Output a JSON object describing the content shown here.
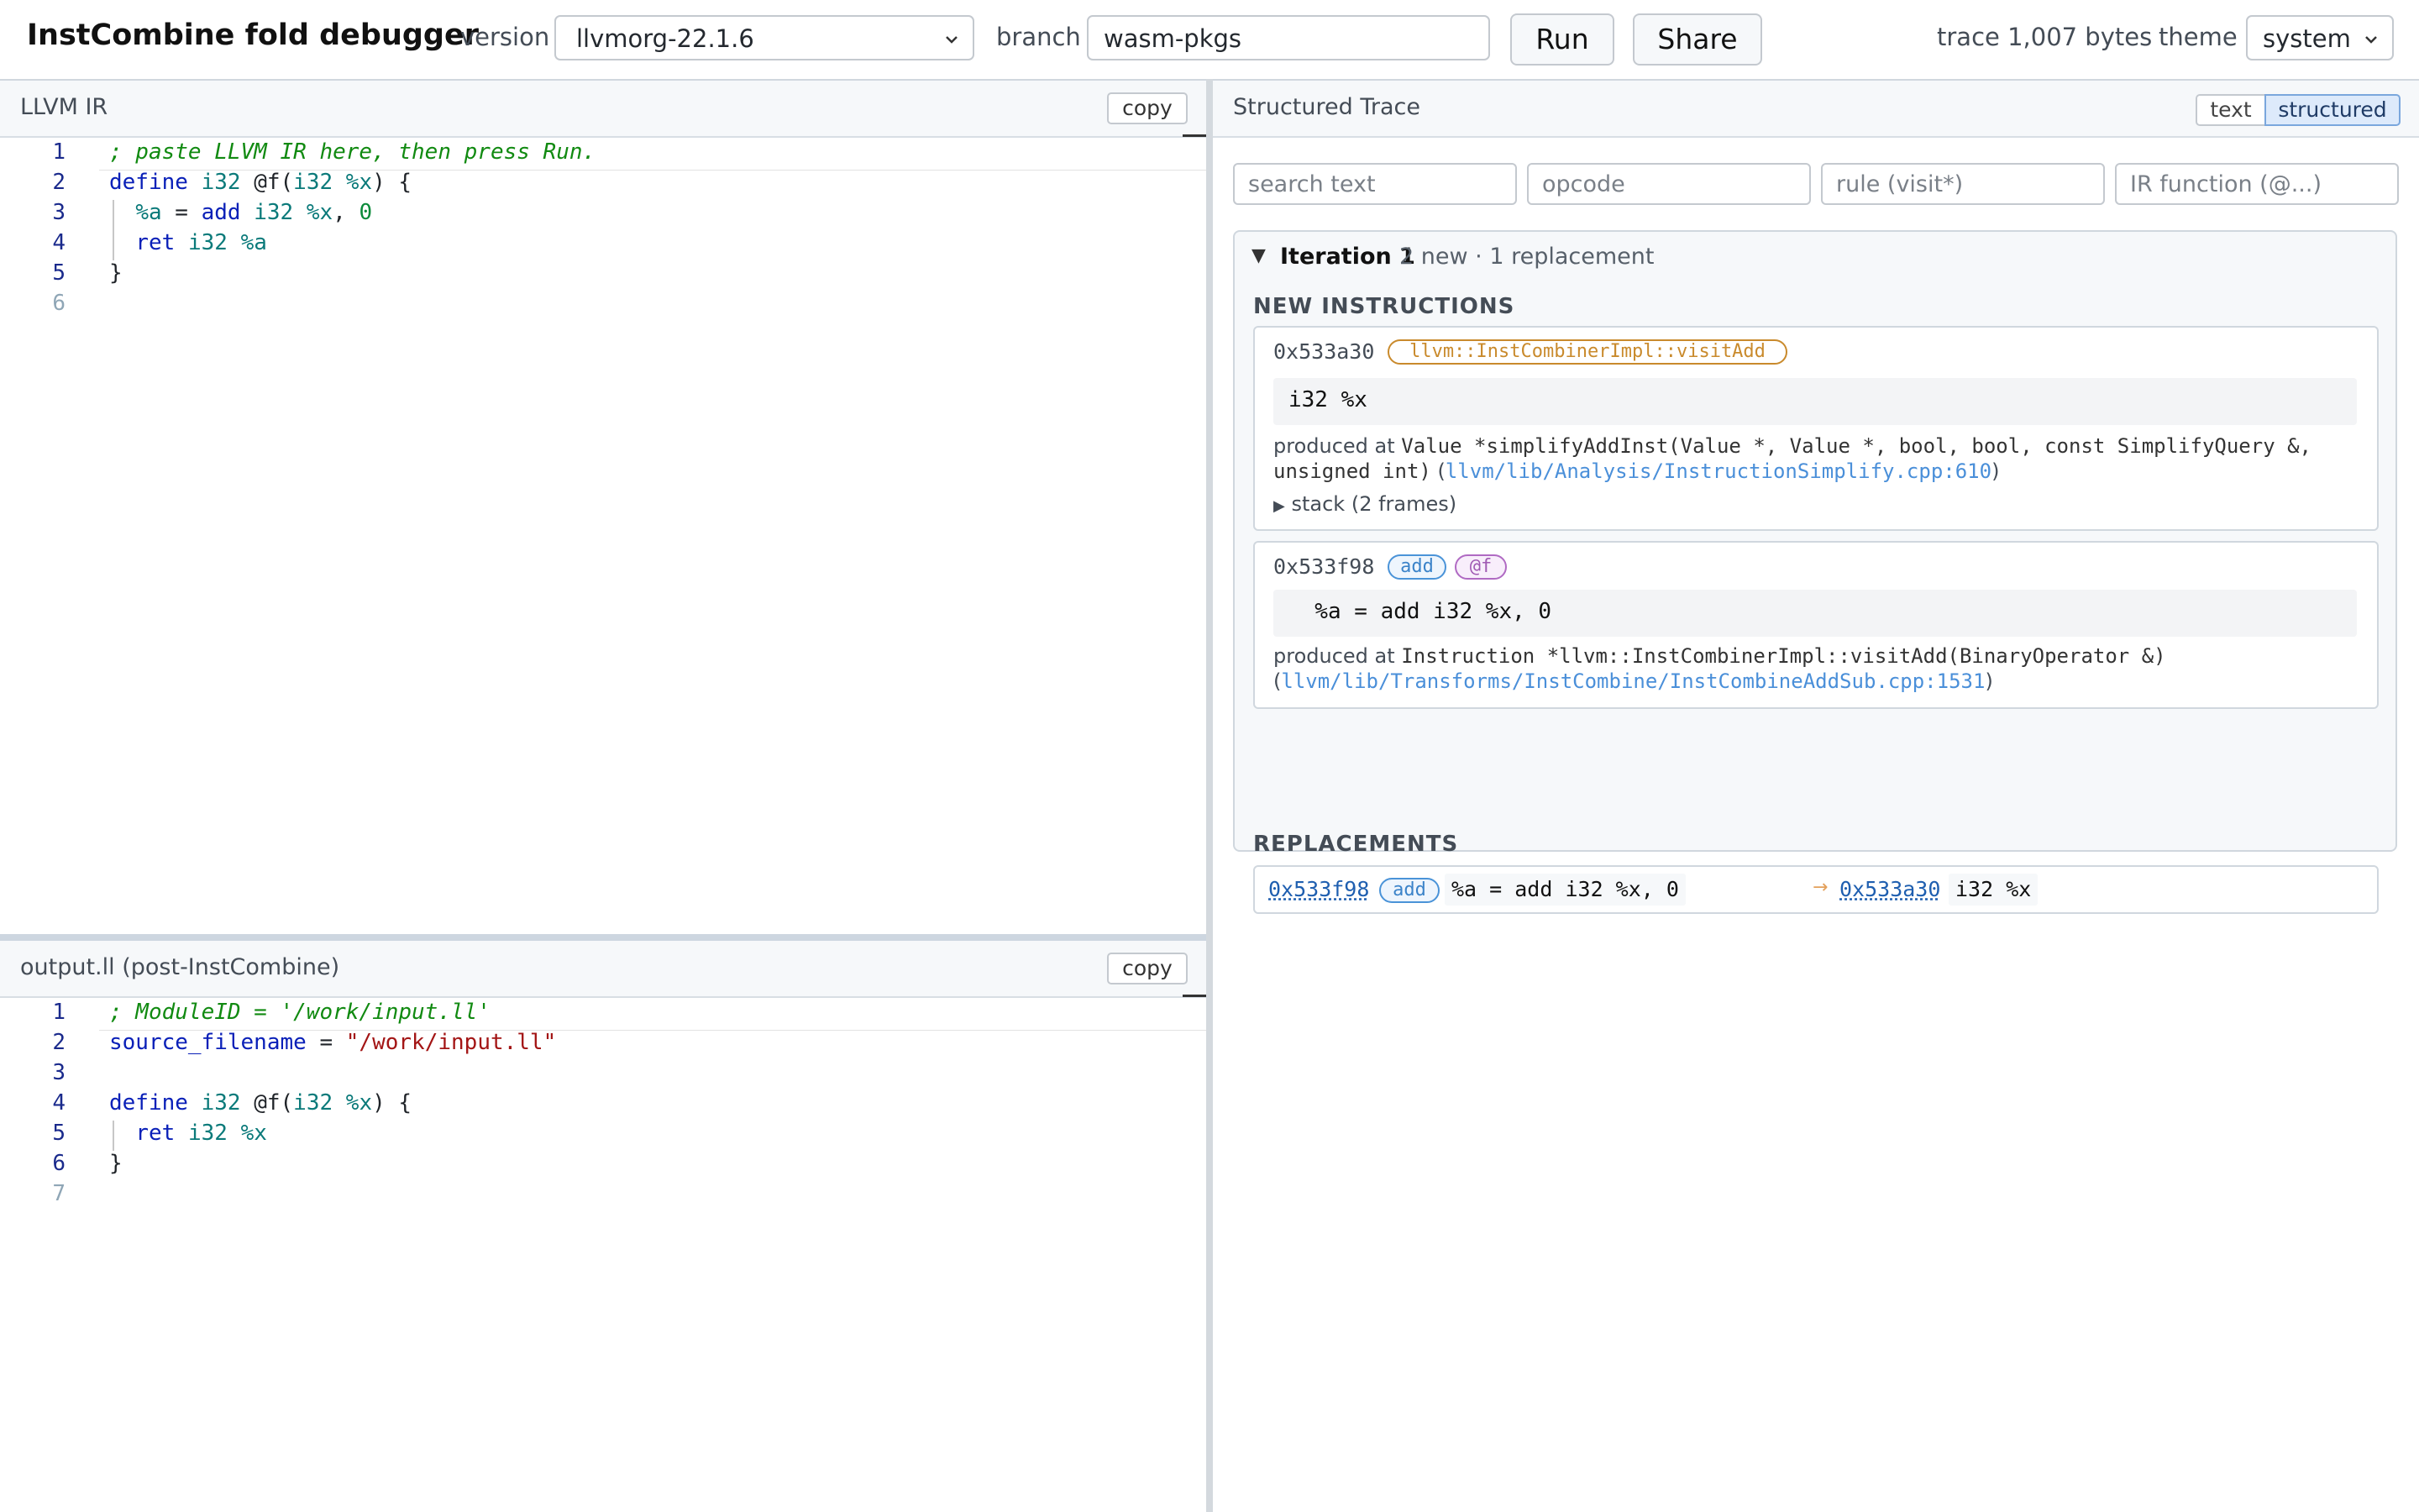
{
  "header": {
    "title": "InstCombine fold debugger",
    "version_label": "version",
    "version_value": "llvmorg-22.1.6",
    "branch_label": "branch",
    "branch_value": "wasm-pkgs",
    "run_label": "Run",
    "share_label": "Share",
    "trace_label": "trace 1,007 bytes",
    "theme_label": "theme",
    "theme_value": "system"
  },
  "input_pane": {
    "title": "LLVM IR",
    "copy_label": "copy",
    "line_numbers": [
      "1",
      "2",
      "3",
      "4",
      "5",
      "6"
    ],
    "lines": [
      [
        {
          "t": "; paste LLVM IR here, then press Run.",
          "c": "cm"
        }
      ],
      [
        {
          "t": "define",
          "c": "kw"
        },
        {
          "t": " ",
          "c": ""
        },
        {
          "t": "i32",
          "c": "ty"
        },
        {
          "t": " @f(",
          "c": "fn"
        },
        {
          "t": "i32",
          "c": "ty"
        },
        {
          "t": " ",
          "c": ""
        },
        {
          "t": "%x",
          "c": "var"
        },
        {
          "t": ") {",
          "c": "fn"
        }
      ],
      [
        {
          "t": "  ",
          "c": ""
        },
        {
          "t": "%a",
          "c": "var"
        },
        {
          "t": " = ",
          "c": "fn"
        },
        {
          "t": "add",
          "c": "kw"
        },
        {
          "t": " ",
          "c": ""
        },
        {
          "t": "i32",
          "c": "ty"
        },
        {
          "t": " ",
          "c": ""
        },
        {
          "t": "%x",
          "c": "var"
        },
        {
          "t": ", ",
          "c": "fn"
        },
        {
          "t": "0",
          "c": "num"
        }
      ],
      [
        {
          "t": "  ",
          "c": ""
        },
        {
          "t": "ret",
          "c": "kw"
        },
        {
          "t": " ",
          "c": ""
        },
        {
          "t": "i32",
          "c": "ty"
        },
        {
          "t": " ",
          "c": ""
        },
        {
          "t": "%a",
          "c": "var"
        }
      ],
      [
        {
          "t": "}",
          "c": "fn"
        }
      ],
      []
    ]
  },
  "output_pane": {
    "title": "output.ll (post-InstCombine)",
    "copy_label": "copy",
    "line_numbers": [
      "1",
      "2",
      "3",
      "4",
      "5",
      "6",
      "7"
    ],
    "lines": [
      [
        {
          "t": "; ModuleID = '/work/input.ll'",
          "c": "cm"
        }
      ],
      [
        {
          "t": "source_filename",
          "c": "kw"
        },
        {
          "t": " = ",
          "c": "fn"
        },
        {
          "t": "\"/work/input.ll\"",
          "c": "str"
        }
      ],
      [],
      [
        {
          "t": "define",
          "c": "kw"
        },
        {
          "t": " ",
          "c": ""
        },
        {
          "t": "i32",
          "c": "ty"
        },
        {
          "t": " @f(",
          "c": "fn"
        },
        {
          "t": "i32",
          "c": "ty"
        },
        {
          "t": " ",
          "c": ""
        },
        {
          "t": "%x",
          "c": "var"
        },
        {
          "t": ") {",
          "c": "fn"
        }
      ],
      [
        {
          "t": "  ",
          "c": ""
        },
        {
          "t": "ret",
          "c": "kw"
        },
        {
          "t": " ",
          "c": ""
        },
        {
          "t": "i32",
          "c": "ty"
        },
        {
          "t": " ",
          "c": ""
        },
        {
          "t": "%x",
          "c": "var"
        }
      ],
      [
        {
          "t": "}",
          "c": "fn"
        }
      ],
      []
    ]
  },
  "trace": {
    "title": "Structured Trace",
    "toggle_text": "text",
    "toggle_structured": "structured",
    "filters": {
      "search": "search text",
      "opcode": "opcode",
      "rule": "rule (visit*)",
      "function": "IR function (@...)"
    },
    "iteration": {
      "title": "Iteration 1",
      "summary": "2 new · 1 replacement",
      "new_heading": "NEW INSTRUCTIONS",
      "cards": [
        {
          "addr": "0x533a30",
          "tag": "llvm::InstCombinerImpl::visitAdd",
          "code": "i32 %x",
          "produced_prefix": "produced at",
          "signature": "Value *simplifyAddInst(Value *, Value *, bool, bool, const SimplifyQuery &, unsigned int)",
          "source": "llvm/lib/Analysis/InstructionSimplify.cpp:610",
          "stack": "stack (2 frames)"
        },
        {
          "addr": "0x533f98",
          "tag_opcode": "add",
          "tag_function": "@f",
          "code": "  %a = add i32 %x, 0",
          "produced_prefix": "produced at",
          "signature": "Instruction *llvm::InstCombinerImpl::visitAdd(BinaryOperator &)",
          "source": "llvm/lib/Transforms/InstCombine/InstCombineAddSub.cpp:1531"
        }
      ],
      "replacements_heading": "REPLACEMENTS",
      "replacement": {
        "from_addr": "0x533f98",
        "from_opcode": "add",
        "from_code": "%a = add i32 %x, 0",
        "arrow": "→",
        "to_addr": "0x533a30",
        "to_code": "i32 %x"
      }
    }
  }
}
